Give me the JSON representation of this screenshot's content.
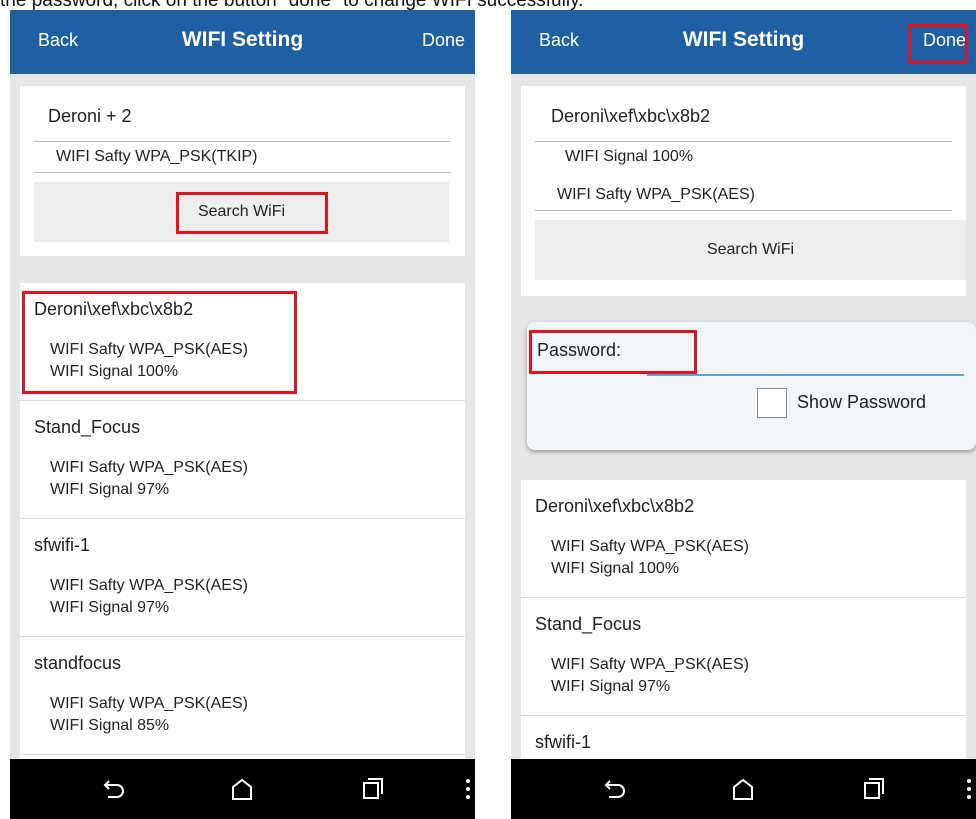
{
  "caption": "the password, click on the button \"done\" to change WIFI successfully.",
  "left": {
    "header": {
      "back": "Back",
      "title": "WIFI Setting",
      "done": "Done"
    },
    "current": {
      "ssid": "Deroni + 2",
      "safety": "WIFI Safty  WPA_PSK(TKIP)"
    },
    "search_button": "Search WiFi",
    "networks": [
      {
        "name": "Deroni\\xef\\xbc\\x8b2",
        "safety": "WIFI Safty  WPA_PSK(AES)",
        "signal": "WIFI Signal  100%"
      },
      {
        "name": "Stand_Focus",
        "safety": "WIFI Safty  WPA_PSK(AES)",
        "signal": "WIFI Signal  97%"
      },
      {
        "name": "sfwifi-1",
        "safety": "WIFI Safty  WPA_PSK(AES)",
        "signal": "WIFI Signal  97%"
      },
      {
        "name": "standfocus",
        "safety": "WIFI Safty  WPA_PSK(AES)",
        "signal": "WIFI Signal  85%"
      }
    ]
  },
  "right": {
    "header": {
      "back": "Back",
      "title": "WIFI Setting",
      "done": "Done"
    },
    "current": {
      "ssid": "Deroni\\xef\\xbc\\x8b2",
      "signal": "WIFI Signal  100%",
      "safety": "WIFI Safty  WPA_PSK(AES)"
    },
    "search_button": "Search WiFi",
    "password_label": "Password:",
    "password_value": "",
    "show_password_label": "Show Password",
    "networks": [
      {
        "name": "Deroni\\xef\\xbc\\x8b2",
        "safety": "WIFI Safty  WPA_PSK(AES)",
        "signal": "WIFI Signal  100%"
      },
      {
        "name": "Stand_Focus",
        "safety": "WIFI Safty  WPA_PSK(AES)",
        "signal": "WIFI Signal  97%"
      },
      {
        "name": "sfwifi-1",
        "safety": "",
        "signal": ""
      }
    ]
  },
  "nav_icons": [
    "back-icon",
    "home-icon",
    "recent-apps-icon",
    "overflow-menu-icon"
  ],
  "colors": {
    "header": "#1f5fa3",
    "highlight": "#e0141e",
    "input_underline": "#5aa5d8"
  }
}
